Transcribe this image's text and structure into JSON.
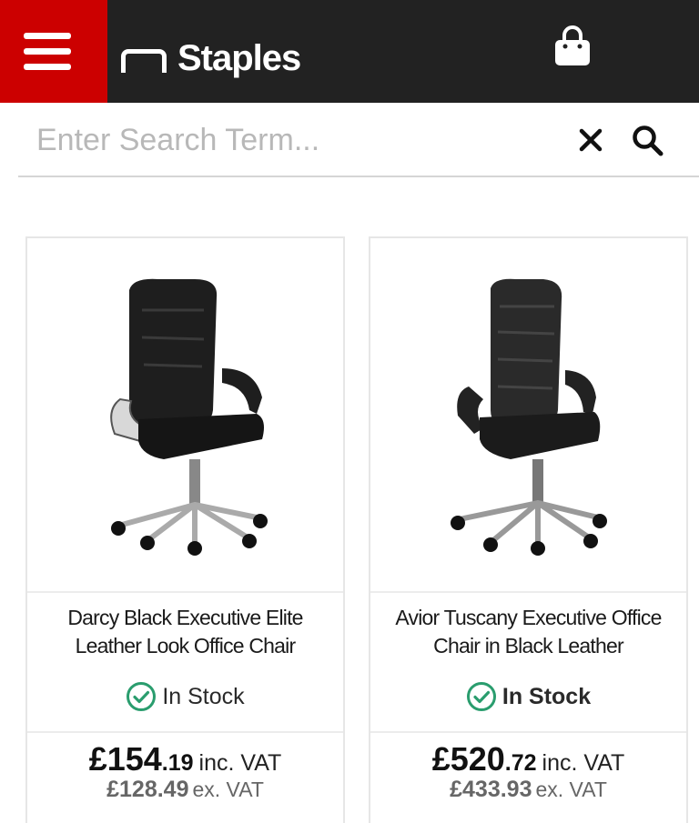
{
  "header": {
    "brand": "Staples",
    "accent_color": "#cc0000",
    "bar_color": "#222222",
    "menu_icon": "hamburger-menu-icon",
    "cart_icon": "shopping-bag-icon"
  },
  "search": {
    "placeholder": "Enter Search Term...",
    "value": "",
    "clear_icon": "close-icon",
    "submit_icon": "search-icon"
  },
  "products": [
    {
      "name": "Darcy Black Executive Elite Leather Look Office Chair",
      "stock": "In Stock",
      "price_main": "£154",
      "price_pence": ".19",
      "inc_vat_label": "inc. VAT",
      "price_ex": "£128.49",
      "ex_vat_label": "ex. VAT"
    },
    {
      "name": "Avior Tuscany Executive Office Chair in Black Leather",
      "stock": "In Stock",
      "price_main": "£520",
      "price_pence": ".72",
      "inc_vat_label": "inc. VAT",
      "price_ex": "£433.93",
      "ex_vat_label": "ex. VAT"
    }
  ],
  "status_color": "#2a9d6e"
}
